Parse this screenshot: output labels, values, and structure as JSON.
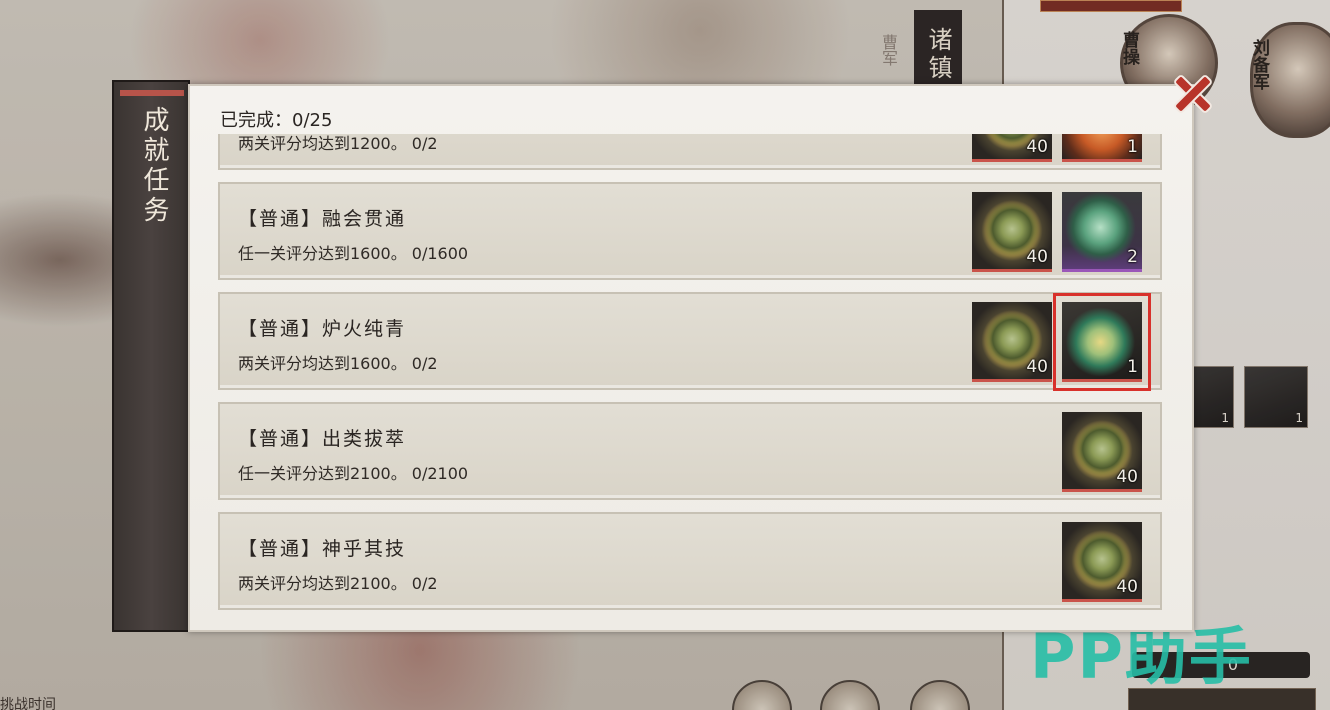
{
  "background": {
    "banner_text": "诸镇",
    "faded_text": "曹军",
    "portraits": [
      {
        "name": "曹操",
        "icon": "cao-cao-portrait"
      },
      {
        "name": "刘备军",
        "icon": "liu-bei-portrait"
      }
    ],
    "equip_slots": [
      {
        "qty": "1",
        "icon": "spear-icon"
      },
      {
        "qty": "1",
        "icon": "helmet-icon"
      }
    ],
    "stat_value": "0",
    "bottom_hint": "挑战时间",
    "watermark": "PP助手"
  },
  "sidebar": {
    "tab_label": "成就任务",
    "accent_color": "#b7544a"
  },
  "panel": {
    "progress_prefix": "已完成：",
    "progress_value": "0/25",
    "tasks": [
      {
        "title": "",
        "desc": "两关评分均达到1200。 0/2",
        "rewards": [
          {
            "icon": "jade-coin-icon",
            "qty": "40",
            "kind": "jade"
          },
          {
            "icon": "orange-item-icon",
            "qty": "1",
            "kind": "orange-item"
          }
        ]
      },
      {
        "title": "【普通】融会贯通",
        "desc": "任一关评分达到1600。 0/1600",
        "rewards": [
          {
            "icon": "jade-coin-icon",
            "qty": "40",
            "kind": "jade"
          },
          {
            "icon": "jade-fragment-icon",
            "qty": "2",
            "kind": "fragment"
          }
        ]
      },
      {
        "title": "【普通】炉火纯青",
        "desc": "两关评分均达到1600。 0/2",
        "rewards": [
          {
            "icon": "jade-coin-icon",
            "qty": "40",
            "kind": "jade"
          },
          {
            "icon": "jade-ornament-icon",
            "qty": "1",
            "kind": "jade-ornament",
            "highlighted": true
          }
        ]
      },
      {
        "title": "【普通】出类拔萃",
        "desc": "任一关评分达到2100。 0/2100",
        "rewards": [
          {
            "icon": "jade-coin-icon",
            "qty": "40",
            "kind": "jade"
          }
        ]
      },
      {
        "title": "【普通】神乎其技",
        "desc": "两关评分均达到2100。 0/2",
        "rewards": [
          {
            "icon": "jade-coin-icon",
            "qty": "40",
            "kind": "jade"
          }
        ]
      }
    ]
  },
  "close_icon": "close-icon",
  "colors": {
    "highlight_outline": "#d8312b",
    "close_red": "#b8342a"
  }
}
